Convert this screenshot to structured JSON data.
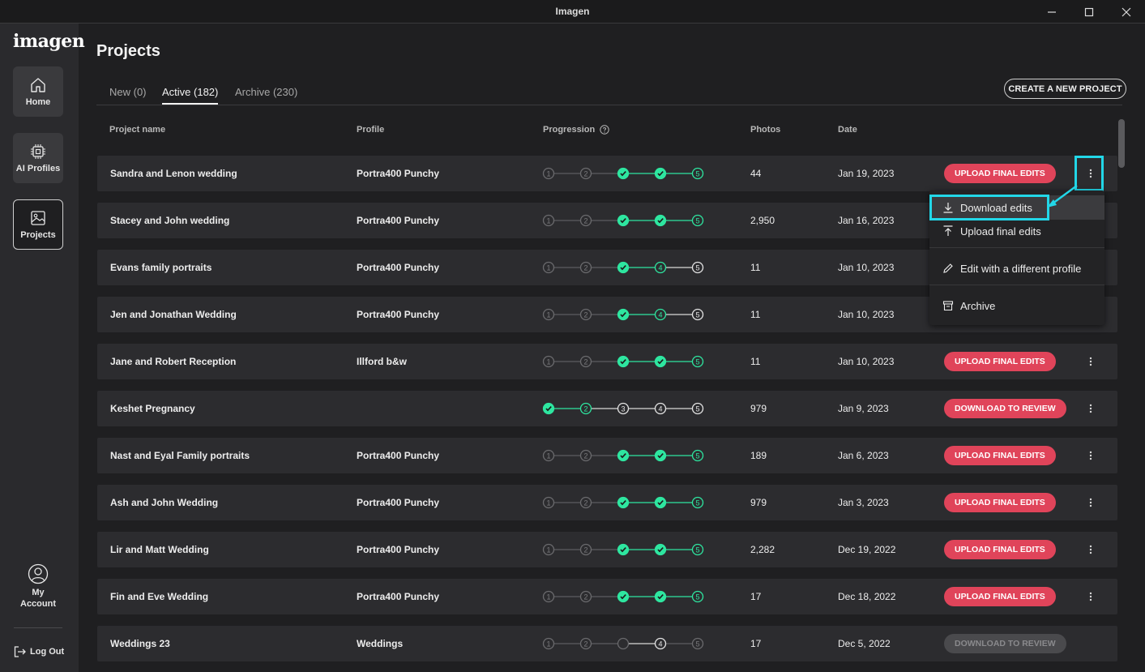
{
  "app": {
    "title": "Imagen",
    "logo": "imagen"
  },
  "sidebar": {
    "items": [
      {
        "label": "Home",
        "icon": "home-icon"
      },
      {
        "label": "AI Profiles",
        "icon": "ai-profiles-icon"
      },
      {
        "label": "Projects",
        "icon": "projects-icon",
        "active": true
      }
    ],
    "account_label": "My Account",
    "logout_label": "Log Out"
  },
  "main": {
    "title": "Projects",
    "tabs": [
      {
        "label": "New (0)"
      },
      {
        "label": "Active (182)",
        "active": true
      },
      {
        "label": "Archive (230)"
      }
    ],
    "create_button": "CREATE A NEW PROJECT",
    "columns": {
      "name": "Project name",
      "profile": "Profile",
      "progression": "Progression",
      "photos": "Photos",
      "date": "Date"
    }
  },
  "projects": [
    {
      "name": "Sandra and Lenon wedding",
      "profile": "Portra400 Punchy",
      "photos": "44",
      "date": "Jan 19, 2023",
      "action": "UPLOAD FINAL EDITS",
      "action_state": "red",
      "steps": [
        "done",
        "done",
        "check",
        "check",
        "current"
      ]
    },
    {
      "name": "Stacey and John wedding",
      "profile": "Portra400 Punchy",
      "photos": "2,950",
      "date": "Jan 16, 2023",
      "action": "",
      "action_state": "none",
      "steps": [
        "done",
        "done",
        "check",
        "check",
        "current"
      ]
    },
    {
      "name": "Evans family portraits",
      "profile": "Portra400 Punchy",
      "photos": "11",
      "date": "Jan 10, 2023",
      "action": "",
      "action_state": "none",
      "steps": [
        "done",
        "done",
        "check",
        "current",
        "white"
      ]
    },
    {
      "name": "Jen and Jonathan Wedding",
      "profile": "Portra400 Punchy",
      "photos": "11",
      "date": "Jan 10, 2023",
      "action": "",
      "action_state": "none",
      "steps": [
        "done",
        "done",
        "check",
        "current",
        "white"
      ]
    },
    {
      "name": "Jane and Robert Reception",
      "profile": "Illford b&w",
      "photos": "11",
      "date": "Jan 10, 2023",
      "action": "UPLOAD FINAL EDITS",
      "action_state": "red",
      "steps": [
        "done",
        "done",
        "check",
        "check",
        "current"
      ]
    },
    {
      "name": "Keshet Pregnancy",
      "profile": "",
      "photos": "979",
      "date": "Jan 9, 2023",
      "action": "DOWNLOAD TO REVIEW",
      "action_state": "red",
      "steps": [
        "check",
        "current",
        "white",
        "white",
        "white"
      ]
    },
    {
      "name": "Nast and Eyal Family portraits",
      "profile": "Portra400 Punchy",
      "photos": "189",
      "date": "Jan 6, 2023",
      "action": "UPLOAD FINAL EDITS",
      "action_state": "red",
      "steps": [
        "done",
        "done",
        "check",
        "check",
        "current"
      ]
    },
    {
      "name": "Ash and John Wedding",
      "profile": "Portra400 Punchy",
      "photos": "979",
      "date": "Jan 3, 2023",
      "action": "UPLOAD FINAL EDITS",
      "action_state": "red",
      "steps": [
        "done",
        "done",
        "check",
        "check",
        "current"
      ]
    },
    {
      "name": "Lir and Matt Wedding",
      "profile": "Portra400 Punchy",
      "photos": "2,282",
      "date": "Dec 19, 2022",
      "action": "UPLOAD FINAL EDITS",
      "action_state": "red",
      "steps": [
        "done",
        "done",
        "check",
        "check",
        "current"
      ]
    },
    {
      "name": "Fin and Eve Wedding",
      "profile": "Portra400 Punchy",
      "photos": "17",
      "date": "Dec 18, 2022",
      "action": "UPLOAD FINAL EDITS",
      "action_state": "red",
      "steps": [
        "done",
        "done",
        "check",
        "check",
        "current"
      ]
    },
    {
      "name": "Weddings 23",
      "profile": "Weddings",
      "photos": "17",
      "date": "Dec 5, 2022",
      "action": "DOWNLOAD TO REVIEW",
      "action_state": "grey",
      "steps": [
        "done",
        "done",
        "spinner",
        "white",
        "done"
      ]
    }
  ],
  "context_menu": {
    "items": [
      {
        "label": "Download edits",
        "icon": "download-icon"
      },
      {
        "label": "Upload final edits",
        "icon": "upload-icon"
      },
      {
        "label": "Edit with a different profile",
        "icon": "pencil-icon"
      },
      {
        "label": "Archive",
        "icon": "archive-icon"
      }
    ]
  },
  "colors": {
    "accent_green": "#2ee6a0",
    "action_red": "#e0445a",
    "highlight_cyan": "#22d7e8"
  }
}
